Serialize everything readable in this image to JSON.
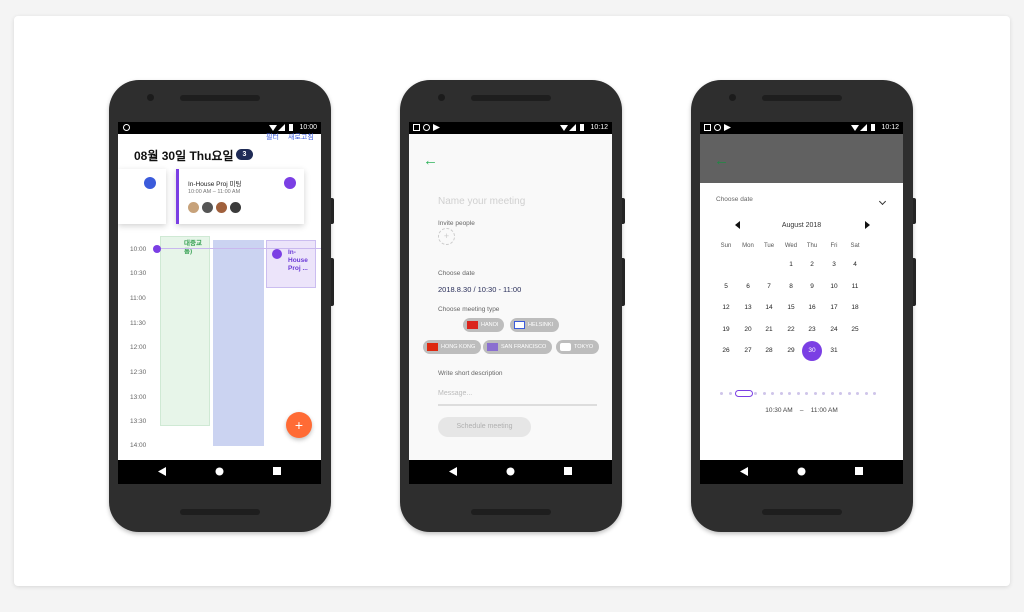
{
  "phone1": {
    "status_time": "10:00",
    "header_actions": [
      "필터",
      "새로고침"
    ],
    "date_title": "08월 30일 Thu요일",
    "event_count": "3",
    "event_card": {
      "title": "In-House Proj 미팅",
      "time": "10:00 AM – 11:00 AM"
    },
    "timeline_hours": [
      "10:00",
      "10:30",
      "11:00",
      "11:30",
      "12:00",
      "12:30",
      "13:00",
      "13:30",
      "14:00"
    ],
    "green_event_label": "대중교 통)",
    "purple_event_label": "In-House Proj ...",
    "fab_label": "+"
  },
  "phone2": {
    "status_time": "10:12",
    "back_icon": "←",
    "name_placeholder": "Name your meeting",
    "invite_label": "Invite people",
    "invite_add": "+",
    "choose_date_label": "Choose date",
    "date_value": "2018.8.30 / 10:30 - 11:00",
    "meeting_type_label": "Choose meeting type",
    "meeting_types": [
      "HANOI",
      "HELSINKI",
      "HONG KONG",
      "SAN FRANCISCO",
      "TOKYO"
    ],
    "description_label": "Write short description",
    "message_placeholder": "Message...",
    "submit_label": "Schedule meeting"
  },
  "phone3": {
    "status_time": "10:12",
    "back_icon": "←",
    "choose_date_label": "Choose date",
    "month_title": "August 2018",
    "weekdays": [
      "Sun",
      "Mon",
      "Tue",
      "Wed",
      "Thu",
      "Fri",
      "Sat"
    ],
    "days": [
      [
        "",
        "",
        "",
        "1",
        "2",
        "3",
        "4"
      ],
      [
        "5",
        "6",
        "7",
        "8",
        "9",
        "10",
        "11"
      ],
      [
        "12",
        "13",
        "14",
        "15",
        "16",
        "17",
        "18"
      ],
      [
        "19",
        "20",
        "21",
        "22",
        "23",
        "24",
        "25"
      ],
      [
        "26",
        "27",
        "28",
        "29",
        "30",
        "31",
        ""
      ]
    ],
    "selected_day": "30",
    "time_start": "10:30 AM",
    "time_sep": "–",
    "time_end": "11:00 AM"
  },
  "colors": {
    "accent": "#7b3fe4",
    "back_arrow": "#2eb35a",
    "fab": "#ff6b35",
    "badge": "#1f2b56"
  }
}
